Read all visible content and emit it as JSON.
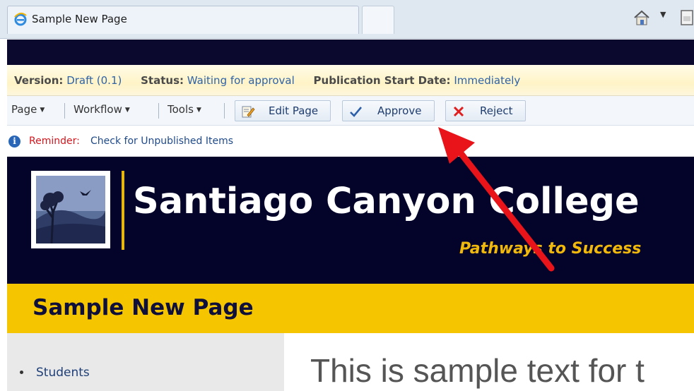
{
  "browser": {
    "tab_title": "Sample New Page",
    "tab_icon": "ie-icon"
  },
  "status": {
    "version_label": "Version:",
    "version_value": "Draft (0.1)",
    "status_label": "Status:",
    "status_value": "Waiting for approval",
    "pubdate_label": "Publication Start Date:",
    "pubdate_value": "Immediately"
  },
  "toolbar": {
    "page_menu": "Page",
    "workflow_menu": "Workflow",
    "tools_menu": "Tools",
    "edit_page": "Edit Page",
    "approve": "Approve",
    "reject": "Reject"
  },
  "reminder": {
    "label": "Reminder:",
    "link": "Check for Unpublished Items"
  },
  "banner": {
    "college_name": "Santiago Canyon College",
    "tagline": "Pathways to Success"
  },
  "page": {
    "title": "Sample New Page",
    "nav_items": [
      "Students"
    ],
    "body_text": "This is sample text for t"
  },
  "colors": {
    "navy": "#04042b",
    "gold": "#f5c500",
    "link_blue": "#2f63a8",
    "annotation_red": "#e8141a"
  }
}
